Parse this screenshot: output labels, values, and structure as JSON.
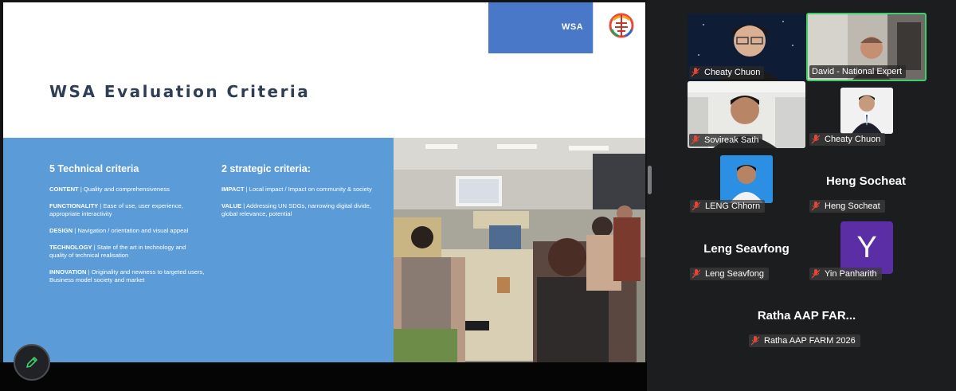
{
  "slide": {
    "brand": "WSA",
    "title": "WSA Evaluation Criteria",
    "technical": {
      "heading": "5 Technical criteria",
      "items": [
        {
          "key": "CONTENT",
          "text": " | Quality and comprehensiveness"
        },
        {
          "key": "FUNCTIONALITY",
          "text": " | Ease of use, user experience, appropriate interactivity"
        },
        {
          "key": "DESIGN",
          "text": " | Navigation / orientation and visual appeal"
        },
        {
          "key": "TECHNOLOGY",
          "text": " | State of the art in technology and quality of technical realisation"
        },
        {
          "key": "INNOVATION",
          "text": " | Originality and newness to targeted users, Business model society and market"
        }
      ]
    },
    "strategic": {
      "heading": "2 strategic criteria:",
      "items": [
        {
          "key": "IMPACT",
          "text": " | Local impact / Impact on community & society"
        },
        {
          "key": "VALUE",
          "text": " | Addressing UN SDGs, narrowing digital divide, global relevance, potential"
        }
      ]
    }
  },
  "participants": {
    "p1": {
      "name": "Cheaty Chuon"
    },
    "p2": {
      "name": "David - National Expert"
    },
    "p3": {
      "name": "Sovireak Sath"
    },
    "p4": {
      "name": "Cheaty Chuon"
    },
    "p5": {
      "name": "LENG Chhorn"
    },
    "p6": {
      "big": "Heng Socheat",
      "name": "Heng Socheat"
    },
    "p7": {
      "big": "Leng Seavfong",
      "name": "Leng Seavfong"
    },
    "p8": {
      "initial": "Y",
      "name": "Yin Panharith"
    },
    "p9": {
      "big": "Ratha AAP FAR...",
      "name": "Ratha AAP FARM 2026"
    }
  },
  "colors": {
    "mic_muted": "#e0473a",
    "active_speaker": "#3ccf6e",
    "slide_blue": "#5b9bd8",
    "avatar_purple": "#5b2ea6"
  },
  "icons": {
    "pen": "pen-icon",
    "mic": "mic-muted-icon"
  }
}
